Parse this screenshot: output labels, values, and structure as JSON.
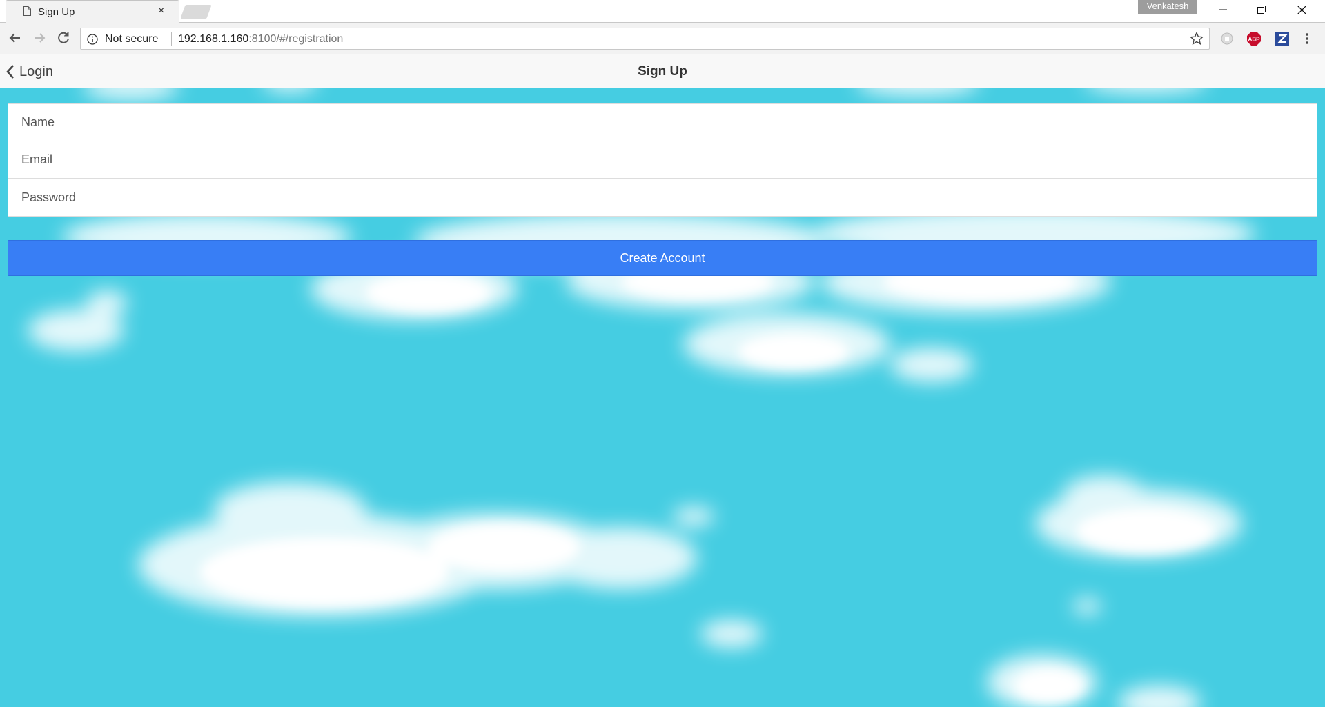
{
  "browser": {
    "tab_title": "Sign Up",
    "tab_close": "×",
    "profile_name": "Venkatesh",
    "security_label": "Not secure",
    "url_host": "192.168.1.160",
    "url_rest": ":8100/#/registration"
  },
  "extensions": [
    "grey-circle-extension-icon",
    "adblock-plus-icon",
    "zotero-icon"
  ],
  "app": {
    "back_label": "Login",
    "page_title": "Sign Up",
    "fields": {
      "name_placeholder": "Name",
      "email_placeholder": "Email",
      "password_placeholder": "Password"
    },
    "create_button": "Create Account"
  },
  "colors": {
    "sky": "#45cde2",
    "primary_button": "#387ef5",
    "abp_red": "#c70d2c",
    "zotero_blue": "#2b4b9b"
  }
}
